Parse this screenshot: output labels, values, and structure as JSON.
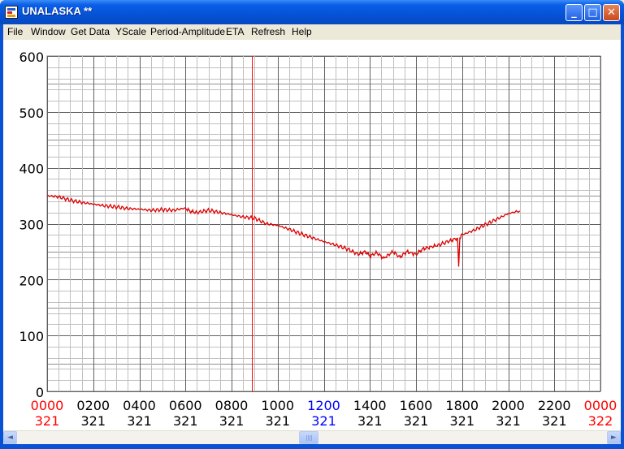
{
  "window": {
    "title": "UNALASKA **",
    "minimize_glyph": "_",
    "maximize_glyph": "□",
    "close_glyph": "✕"
  },
  "menu": [
    "File",
    "Window",
    "Get Data",
    "YScale",
    "Period-Amplitude",
    "ETA",
    "Refresh",
    "Help"
  ],
  "scrollbar": {
    "left_glyph": "◄",
    "right_glyph": "►"
  },
  "chart_data": {
    "type": "line",
    "ylim": [
      0,
      600
    ],
    "yticks": [
      "0",
      "100",
      "200",
      "300",
      "400",
      "500",
      "600"
    ],
    "x_axis_unit": "hour (0-24)",
    "xlim": [
      0,
      24
    ],
    "xticks": [
      {
        "hour": "0000",
        "day": "321",
        "color": "#ff0000"
      },
      {
        "hour": "0200",
        "day": "321",
        "color": "#000000"
      },
      {
        "hour": "0400",
        "day": "321",
        "color": "#000000"
      },
      {
        "hour": "0600",
        "day": "321",
        "color": "#000000"
      },
      {
        "hour": "0800",
        "day": "321",
        "color": "#000000"
      },
      {
        "hour": "1000",
        "day": "321",
        "color": "#000000"
      },
      {
        "hour": "1200",
        "day": "321",
        "color": "#0000ff"
      },
      {
        "hour": "1400",
        "day": "321",
        "color": "#000000"
      },
      {
        "hour": "1600",
        "day": "321",
        "color": "#000000"
      },
      {
        "hour": "1800",
        "day": "321",
        "color": "#000000"
      },
      {
        "hour": "2000",
        "day": "321",
        "color": "#000000"
      },
      {
        "hour": "2200",
        "day": "321",
        "color": "#000000"
      },
      {
        "hour": "0000",
        "day": "322",
        "color": "#ff0000"
      }
    ],
    "cursor_hour": 8.9,
    "series_color": "#dd0000",
    "series": [
      {
        "x": [
          0,
          0.5,
          1,
          1.5,
          2,
          2.5,
          3,
          3.5,
          4,
          4.5,
          5,
          5.5,
          6,
          6.2,
          6.5,
          7,
          7.5,
          8,
          8.5,
          9,
          9.5,
          10,
          10.5,
          11,
          11.5,
          12,
          12.5,
          13,
          13.5,
          13.8,
          14,
          14.3,
          14.6,
          15,
          15.3,
          15.6,
          16,
          16.3,
          16.6,
          17,
          17.5,
          17.8,
          17.85,
          17.9,
          18,
          18.5,
          19,
          19.5,
          20,
          20.5
        ],
        "y": [
          350,
          348,
          342,
          338,
          335,
          332,
          330,
          327,
          326,
          324,
          325,
          324,
          328,
          322,
          320,
          324,
          320,
          316,
          312,
          310,
          300,
          297,
          290,
          282,
          275,
          268,
          262,
          255,
          245,
          250,
          242,
          248,
          238,
          250,
          240,
          250,
          245,
          255,
          258,
          262,
          270,
          274,
          222,
          275,
          280,
          288,
          298,
          308,
          318,
          323
        ]
      }
    ]
  }
}
